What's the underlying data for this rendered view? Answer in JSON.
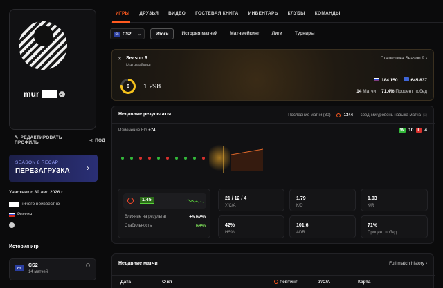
{
  "sidebar": {
    "nickname": "mur",
    "edit_profile": "РЕДАКТИРОВАТЬ ПРОФИЛЬ",
    "share_truncated": "ПОД",
    "recap_sub": "SEASON 8 RECAP",
    "recap_main": "ПЕРЕЗАГРУЗКА",
    "member_since": "Участник с 30 авг. 2026 г.",
    "ign_suffix": "ничего неизвестно",
    "country": "Россия",
    "history_title": "История игр",
    "game_name": "CS2",
    "game_matches": "14 матчей"
  },
  "nav": {
    "tabs": [
      "ИГРЫ",
      "ДРУЗЬЯ",
      "ВИДЕО",
      "ГОСТЕВАЯ КНИГА",
      "ИНВЕНТАРЬ",
      "КЛУБЫ",
      "КОМАНДЫ"
    ]
  },
  "subnav": {
    "game": "CS2",
    "tabs": [
      "Итоги",
      "История матчей",
      "Матчмейкинг",
      "Лиги",
      "Турниры"
    ]
  },
  "season": {
    "title": "Season 9",
    "mode": "Матчмейкинг",
    "stats_link": "Статистика Season 9",
    "level": "6",
    "elo": "1 298",
    "rank_country": "184 150",
    "rank_world": "645 837",
    "matches_val": "14",
    "matches_lbl": "Матчи",
    "winrate_val": "71.4%",
    "winrate_lbl": "Процент побед"
  },
  "results": {
    "title": "Недавние результаты",
    "last_matches": "Последние матчи (30)",
    "avg_val": "1344",
    "avg_lbl": "— средний уровень навыка матча",
    "elo_change_lbl": "Изменение Elo",
    "elo_change_val": "+74",
    "wins": "10",
    "losses": "4",
    "dot_results": [
      "W",
      "W",
      "L",
      "L",
      "W",
      "L",
      "W",
      "W",
      "W",
      "L"
    ],
    "colors": {
      "win": "#33b83a",
      "loss": "#d8312d",
      "accent": "#ff5a1f"
    },
    "impact_val": "1.45",
    "impact_lbl": "Влияние на результат",
    "impact_change": "+5.62%",
    "stability_lbl": "Стабильность",
    "stability_val": "68%",
    "stats": [
      {
        "value": "21 / 12 / 4",
        "label": "У/С/А"
      },
      {
        "value": "1.79",
        "label": "К/D"
      },
      {
        "value": "1.03",
        "label": "К/R"
      },
      {
        "value": "42%",
        "label": "HS%"
      },
      {
        "value": "101.6",
        "label": "ADR"
      },
      {
        "value": "71%",
        "label": "Процент побед"
      }
    ]
  },
  "recent": {
    "title": "Недавние матчи",
    "link": "Full match history",
    "columns": [
      "Дата",
      "Счет",
      "Рейтинг",
      "У/С/А",
      "Карта"
    ]
  }
}
